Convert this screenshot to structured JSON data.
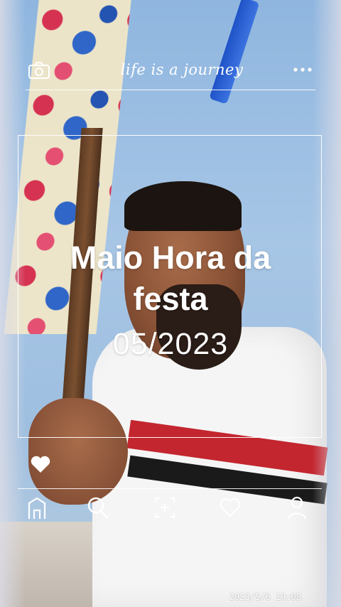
{
  "header": {
    "tagline": "life is a journey",
    "left_icon": "camera-icon",
    "right_icon": "more-dots-icon"
  },
  "card": {
    "title": "Maio Hora da festa",
    "date": "05/2023"
  },
  "reaction": {
    "icon": "heart-icon"
  },
  "bottom_nav": {
    "items": [
      {
        "icon": "home-icon"
      },
      {
        "icon": "search-icon"
      },
      {
        "icon": "add-photo-icon"
      },
      {
        "icon": "favorite-icon"
      },
      {
        "icon": "profile-icon"
      }
    ]
  },
  "timestamp": "2023/5/6 19:08",
  "colors": {
    "overlay": "#ffffff",
    "wall": "#9fbfe0",
    "shirt_red": "#c3262f"
  }
}
